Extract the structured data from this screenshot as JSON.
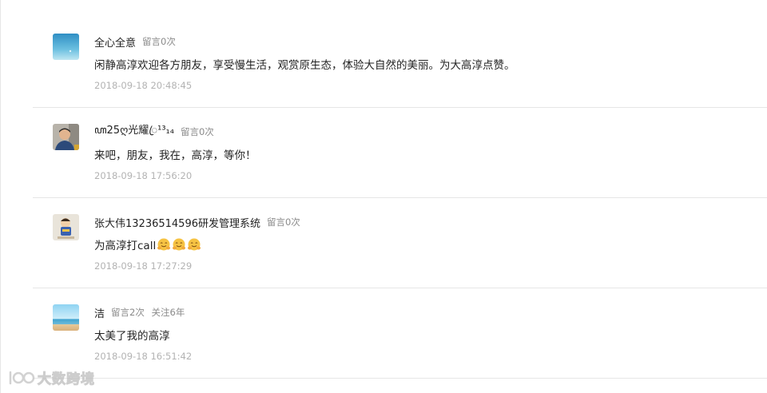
{
  "comments": [
    {
      "nickname": "全心全意",
      "stats": [
        "留言0次"
      ],
      "content": "闲静高淳欢迎各方朋友，享受慢生活，观赏原生态，体验大自然的美丽。为大高淳点赞。",
      "time": "2018-09-18 20:48:45",
      "avatar": "sky-gradient"
    },
    {
      "nickname": "ꦲ25ღ光耀ꦿ︎¹³₁₄",
      "stats": [
        "留言0次"
      ],
      "content": "来吧，朋友，我在，高淳，等你！",
      "time": "2018-09-18 17:56:20",
      "avatar": "man-portrait"
    },
    {
      "nickname": "张大伟13236514596研发管理系统",
      "stats": [
        "留言0次"
      ],
      "content": "为高淳打call",
      "emoji_count": 3,
      "emoji_icon": "hugging-face-icon",
      "time": "2018-09-18 17:27:29",
      "avatar": "cartoon-sticker"
    },
    {
      "nickname": "洁",
      "stats": [
        "留言2次",
        "关注6年"
      ],
      "content": "太美了我的高淳",
      "time": "2018-09-18 16:51:42",
      "avatar": "beach-scene"
    }
  ],
  "watermark": {
    "text": "大数跨境",
    "icon": "brand-logo-icon"
  },
  "colors": {
    "divider": "#e6e6e6",
    "nickname": "#222222",
    "meta": "#8a8a8a",
    "timestamp": "#b3b3b3"
  }
}
